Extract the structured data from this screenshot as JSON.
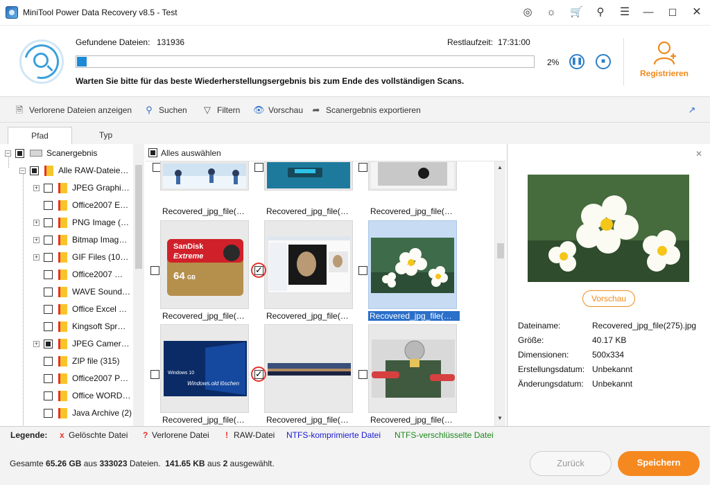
{
  "window": {
    "title": "MiniTool Power Data Recovery v8.5 - Test",
    "icons": [
      "disc-icon",
      "headset-icon",
      "cart-icon",
      "key-icon",
      "menu-icon",
      "minimize-icon",
      "maximize-icon",
      "close-icon"
    ]
  },
  "header": {
    "found_label": "Gefundene Dateien:",
    "found_value": "131936",
    "remaining_label": "Restlaufzeit:",
    "remaining_value": "17:31:00",
    "progress_percent": 2,
    "progress_text": "2%",
    "status_message": "Warten Sie bitte für das beste Wiederherstellungsergebnis bis zum Ende des vollständigen Scans.",
    "pause_icon": "pause-icon",
    "stop_icon": "stop-icon",
    "register_label": "Registrieren"
  },
  "toolbar": {
    "show_lost": "Verlorene Dateien anzeigen",
    "search": "Suchen",
    "filter": "Filtern",
    "preview": "Vorschau",
    "export": "Scanergebnis exportieren"
  },
  "tabs": {
    "path": "Pfad",
    "type": "Typ"
  },
  "tree": {
    "root": "Scanergebnis",
    "raw": "Alle RAW-Dateie…",
    "items": [
      {
        "label": "JPEG Graphi…",
        "expandable": true,
        "partial": false
      },
      {
        "label": "Office2007 E…",
        "expandable": false,
        "partial": false
      },
      {
        "label": "PNG Image (…",
        "expandable": true,
        "partial": false
      },
      {
        "label": "Bitmap Imag…",
        "expandable": true,
        "partial": false
      },
      {
        "label": "GIF Files (10…",
        "expandable": true,
        "partial": false
      },
      {
        "label": "Office2007 …",
        "expandable": false,
        "partial": false
      },
      {
        "label": "WAVE Sound…",
        "expandable": false,
        "partial": false
      },
      {
        "label": "Office Excel …",
        "expandable": false,
        "partial": false
      },
      {
        "label": "Kingsoft Spr…",
        "expandable": false,
        "partial": false
      },
      {
        "label": "JPEG Camer…",
        "expandable": true,
        "partial": true
      },
      {
        "label": "ZIP file (315)",
        "expandable": false,
        "partial": false
      },
      {
        "label": "Office2007 P…",
        "expandable": false,
        "partial": false
      },
      {
        "label": "Office WORD…",
        "expandable": false,
        "partial": false
      },
      {
        "label": "Java Archive (2)",
        "expandable": false,
        "partial": false
      }
    ]
  },
  "grid": {
    "select_all": "Alles auswählen",
    "file_name": "Recovered_jpg_file(…",
    "rows": [
      [
        {
          "checked": false,
          "selected": false,
          "image": "skiers"
        },
        {
          "checked": false,
          "selected": false,
          "image": "blue-device"
        },
        {
          "checked": false,
          "selected": false,
          "image": "laptop"
        }
      ],
      [
        {
          "checked": false,
          "selected": false,
          "image": "sdcard"
        },
        {
          "checked": true,
          "selected": false,
          "image": "screenshot"
        },
        {
          "checked": false,
          "selected": true,
          "image": "flowers"
        }
      ],
      [
        {
          "checked": false,
          "selected": false,
          "image": "windows10"
        },
        {
          "checked": true,
          "selected": false,
          "image": "panorama"
        },
        {
          "checked": false,
          "selected": false,
          "image": "circuit"
        }
      ]
    ],
    "sdcard_brand": "SanDisk",
    "sdcard_line": "Extreme",
    "sdcard_capacity": "64",
    "sdcard_unit": "GB",
    "win_title": "Windows 10",
    "win_subtitle": "Windows.old löschen"
  },
  "preview": {
    "button": "Vorschau",
    "close_icon": "close-icon",
    "fields": [
      {
        "label": "Dateiname:",
        "value": "Recovered_jpg_file(275).jpg"
      },
      {
        "label": "Größe:",
        "value": "40.17 KB"
      },
      {
        "label": "Dimensionen:",
        "value": "500x334"
      },
      {
        "label": "Erstellungsdatum:",
        "value": "Unbekannt"
      },
      {
        "label": "Änderungsdatum:",
        "value": "Unbekannt"
      }
    ]
  },
  "legend": {
    "title": "Legende:",
    "deleted": "Gelöschte Datei",
    "lost": "Verlorene Datei",
    "raw": "RAW-Datei",
    "ntfs_compressed": "NTFS-komprimierte Datei",
    "ntfs_encrypted": "NTFS-verschlüsselte Datei",
    "deleted_mark": "x",
    "lost_mark": "?",
    "raw_mark": "!",
    "colors": {
      "deleted": "#e8302a",
      "compressed": "#1a1ad0",
      "encrypted": "#1a8a1a"
    }
  },
  "footer": {
    "total_prefix": "Gesamte",
    "total_size": "65.26 GB",
    "mid1": "aus",
    "total_files": "333023",
    "mid2": "Dateien.",
    "sel_size": "141.65 KB",
    "mid3": "aus",
    "sel_count": "2",
    "suffix": "ausgewählt.",
    "back": "Zurück",
    "save": "Speichern"
  },
  "colors": {
    "accent_blue": "#1d8ad8",
    "orange": "#f5891f",
    "selection": "#2a6fc9"
  }
}
